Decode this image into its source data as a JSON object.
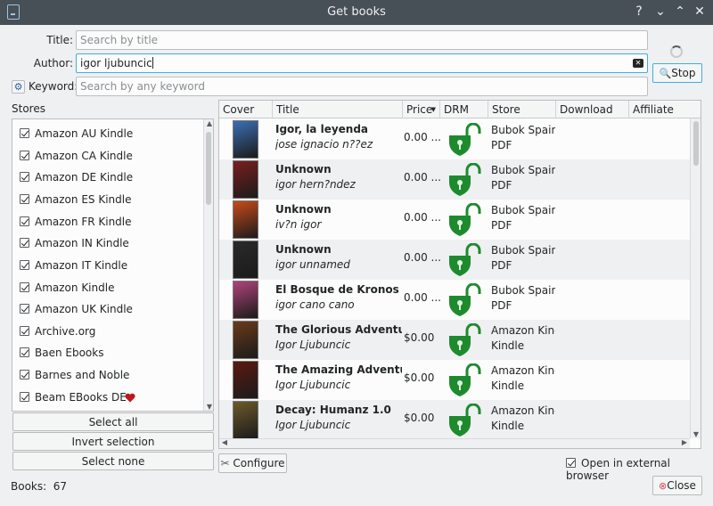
{
  "window": {
    "title": "Get books",
    "buttons": [
      "?",
      "⌄",
      "⌃",
      "✕"
    ]
  },
  "form": {
    "title_label": "Title:",
    "title_placeholder": "Search by title",
    "author_label": "Author:",
    "author_value": "igor ljubuncic",
    "keyword_label": "Keyword:",
    "keyword_placeholder": "Search by any keyword",
    "stop_label": "Stop"
  },
  "stores": {
    "heading": "Stores",
    "items": [
      "Amazon AU Kindle",
      "Amazon CA Kindle",
      "Amazon DE Kindle",
      "Amazon ES Kindle",
      "Amazon FR Kindle",
      "Amazon IN Kindle",
      "Amazon IT Kindle",
      "Amazon Kindle",
      "Amazon UK Kindle",
      "Archive.org",
      "Baen Ebooks",
      "Barnes and Noble",
      "Beam EBooks DE"
    ],
    "select_all": "Select all",
    "invert_selection": "Invert selection",
    "select_none": "Select none"
  },
  "table": {
    "columns": [
      "Cover",
      "Title",
      "Price",
      "DRM",
      "Store",
      "Download",
      "Affiliate"
    ],
    "rows": [
      {
        "title": "Igor, la leyenda",
        "author": "jose ignacio n??ez",
        "price": "0.00 ...",
        "store": "Bubok Spain",
        "format": "PDF",
        "cover_color": "#3a6fb5"
      },
      {
        "title": "Unknown",
        "author": "igor hern?ndez",
        "price": "0.00 ...",
        "store": "Bubok Spain",
        "format": "PDF",
        "cover_color": "#7a1e1e"
      },
      {
        "title": "Unknown",
        "author": "iv?n igor",
        "price": "0.00 ...",
        "store": "Bubok Spain",
        "format": "PDF",
        "cover_color": "#c84a1a"
      },
      {
        "title": "Unknown",
        "author": "igor unnamed",
        "price": "0.00 ...",
        "store": "Bubok Spain",
        "format": "PDF",
        "cover_color": "#2a2a2a"
      },
      {
        "title": "El Bosque de Kronos",
        "author": "igor cano cano",
        "price": "0.00 ...",
        "store": "Bubok Spain",
        "format": "PDF",
        "cover_color": "#b0447a"
      },
      {
        "title": "The Glorious Adventures of",
        "author": "Igor Ljubuncic",
        "price": "$0.00",
        "store": "Amazon Kindl",
        "format": "Kindle",
        "cover_color": "#6a3a1a"
      },
      {
        "title": "The Amazing Adventures o",
        "author": "Igor Ljubuncic",
        "price": "$0.00",
        "store": "Amazon Kindl",
        "format": "Kindle",
        "cover_color": "#5a1a10"
      },
      {
        "title": "Decay: Humanz 1.0",
        "author": "Igor Ljubuncic",
        "price": "$0.00",
        "store": "Amazon Kindl",
        "format": "Kindle",
        "cover_color": "#6b5a2a"
      }
    ]
  },
  "configure_label": "Configure",
  "open_external_label": "Open in external browser",
  "books_count": "Books:  67",
  "close_label": "Close",
  "colors": {
    "drm_lock": "#1e8a2e",
    "heart": "#c0161c",
    "accent": "#3daee9"
  }
}
